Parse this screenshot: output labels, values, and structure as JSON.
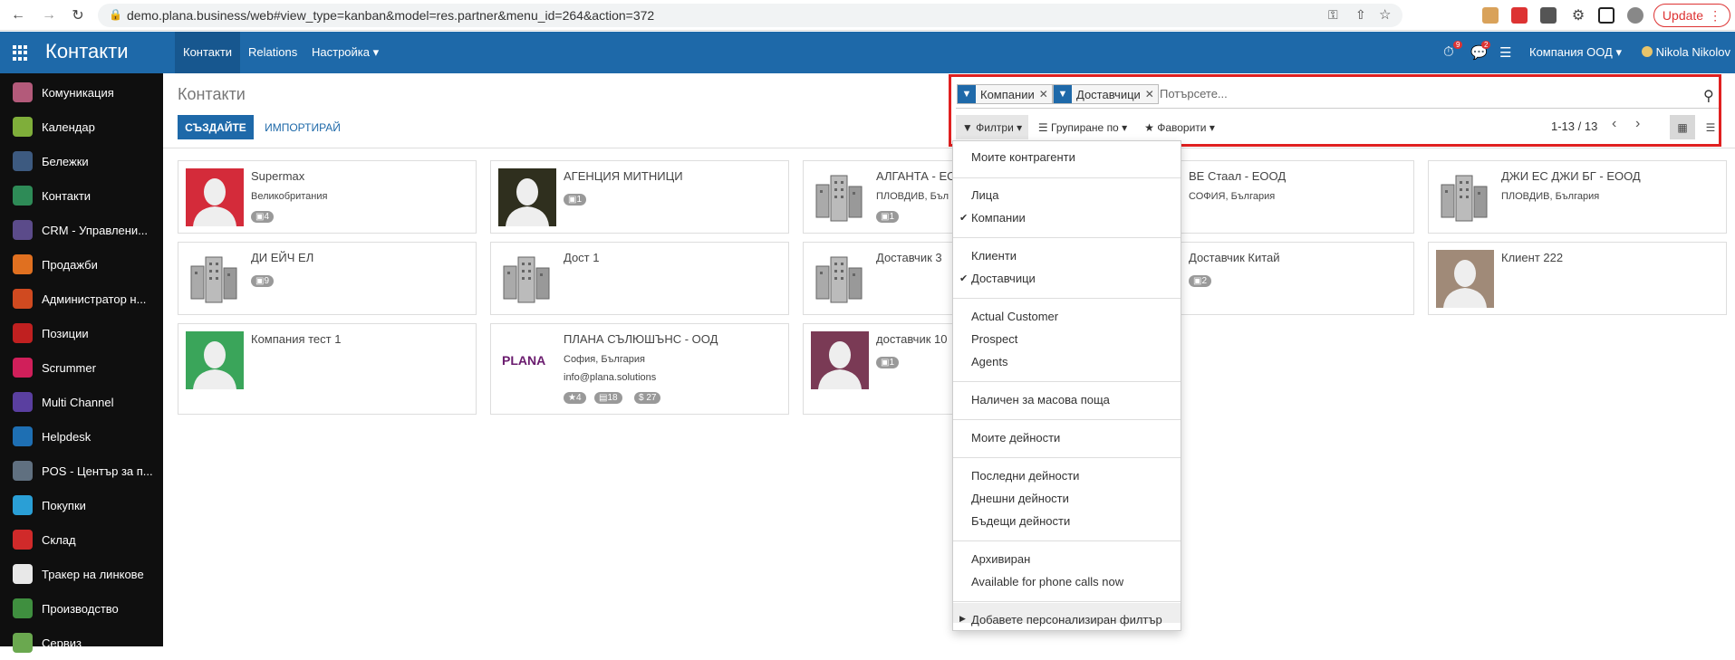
{
  "browser": {
    "url": "demo.plana.business/web#view_type=kanban&model=res.partner&menu_id=264&action=372",
    "update_label": "Update"
  },
  "topnav": {
    "app_title": "Контакти",
    "menu": [
      "Контакти",
      "Relations",
      "Настройка"
    ],
    "company": "Компания ООД",
    "user": "Nikola Nikolov",
    "activity_count": "9",
    "message_count": "2"
  },
  "sidebar": {
    "items": [
      {
        "label": "Комуникация",
        "color": "#b35a7a"
      },
      {
        "label": "Календар",
        "color": "#7fae3a"
      },
      {
        "label": "Бележки",
        "color": "#3d5a80"
      },
      {
        "label": "Контакти",
        "color": "#2e8b57"
      },
      {
        "label": "CRM - Управлени...",
        "color": "#5b4b8a"
      },
      {
        "label": "Продажби",
        "color": "#e07020"
      },
      {
        "label": "Администратор н...",
        "color": "#d04a20"
      },
      {
        "label": "Позиции",
        "color": "#c02020"
      },
      {
        "label": "Scrummer",
        "color": "#d01f5a"
      },
      {
        "label": "Multi Channel",
        "color": "#5a3fa0"
      },
      {
        "label": "Helpdesk",
        "color": "#1e6fb3"
      },
      {
        "label": "POS - Център за п...",
        "color": "#607080"
      },
      {
        "label": "Покупки",
        "color": "#2a9fd6"
      },
      {
        "label": "Склад",
        "color": "#d02a2a"
      },
      {
        "label": "Тракер на линкове",
        "color": "#e8e8e8"
      },
      {
        "label": "Производство",
        "color": "#3f8f3f"
      },
      {
        "label": "Сервиз",
        "color": "#6aa84f"
      }
    ]
  },
  "control": {
    "breadcrumb": "Контакти",
    "create": "СЪЗДАЙТЕ",
    "import": "ИМПОРТИРАЙ",
    "facets": [
      "Компании",
      "Доставчици"
    ],
    "search_placeholder": "Потърсете...",
    "filters": "Филтри",
    "group_by": "Групиране по",
    "favorites": "Фаворити",
    "pager": "1-13 / 13"
  },
  "cards": [
    {
      "name": "Supermax",
      "line1": "Великобритания",
      "badges": [
        "4"
      ],
      "avatar": "person",
      "color": "#d42b3a"
    },
    {
      "name": "АГЕНЦИЯ МИТНИЦИ",
      "line1": "",
      "badges": [
        "1"
      ],
      "avatar": "person",
      "color": "#2f2f1e"
    },
    {
      "name": "АЛГАНТА - ЕО",
      "line1": "ПЛОВДИВ, Бъл",
      "badges": [
        "1"
      ],
      "avatar": "building",
      "color": ""
    },
    {
      "name": "ВЕ Стаал - ЕООД",
      "line1": "СОФИЯ, България",
      "badges": [],
      "avatar": "none",
      "color": ""
    },
    {
      "name": "ДЖИ ЕС ДЖИ БГ - ЕООД",
      "line1": "ПЛОВДИВ, България",
      "badges": [],
      "avatar": "building",
      "color": ""
    },
    {
      "name": "ДИ ЕЙЧ ЕЛ",
      "line1": "",
      "badges": [
        "9"
      ],
      "avatar": "building",
      "color": ""
    },
    {
      "name": "Дост 1",
      "line1": "",
      "badges": [],
      "avatar": "building",
      "color": ""
    },
    {
      "name": "Доставчик 3",
      "line1": "",
      "badges": [],
      "avatar": "building",
      "color": ""
    },
    {
      "name": "Доставчик Китай",
      "line1": "",
      "badges": [
        "2"
      ],
      "avatar": "none",
      "color": ""
    },
    {
      "name": "Клиент 222",
      "line1": "",
      "badges": [],
      "avatar": "person",
      "color": "#a08a78"
    },
    {
      "name": "Компания тест 1",
      "line1": "",
      "badges": [],
      "avatar": "person",
      "color": "#3aa55a"
    },
    {
      "name": "ПЛАНА СЪЛЮШЪНС - ООД",
      "line1": "София, България",
      "line2": "info@plana.solutions",
      "badges": [
        "4",
        "18",
        "$ 27"
      ],
      "avatar": "logo",
      "color": "",
      "logo_text": "PLANA"
    },
    {
      "name": "доставчик 10",
      "line1": "",
      "badges": [
        "1"
      ],
      "avatar": "person",
      "color": "#7a3a55"
    }
  ],
  "dropdown": {
    "items": [
      {
        "label": "Моите контрагенти",
        "checked": false
      },
      {
        "label": "Лица",
        "checked": false
      },
      {
        "label": "Компании",
        "checked": true
      },
      {
        "label": "Клиенти",
        "checked": false
      },
      {
        "label": "Доставчици",
        "checked": true
      },
      {
        "label": "Actual Customer",
        "checked": false
      },
      {
        "label": "Prospect",
        "checked": false
      },
      {
        "label": "Agents",
        "checked": false
      },
      {
        "label": "Наличен за масова поща",
        "checked": false
      },
      {
        "label": "Моите дейности",
        "checked": false
      },
      {
        "label": "Последни дейности",
        "checked": false
      },
      {
        "label": "Днешни дейности",
        "checked": false
      },
      {
        "label": "Бъдещи дейности",
        "checked": false
      },
      {
        "label": "Архивиран",
        "checked": false
      },
      {
        "label": "Available for phone calls now",
        "checked": false
      },
      {
        "label": "Добавете персонализиран филтър",
        "checked": false
      }
    ]
  }
}
